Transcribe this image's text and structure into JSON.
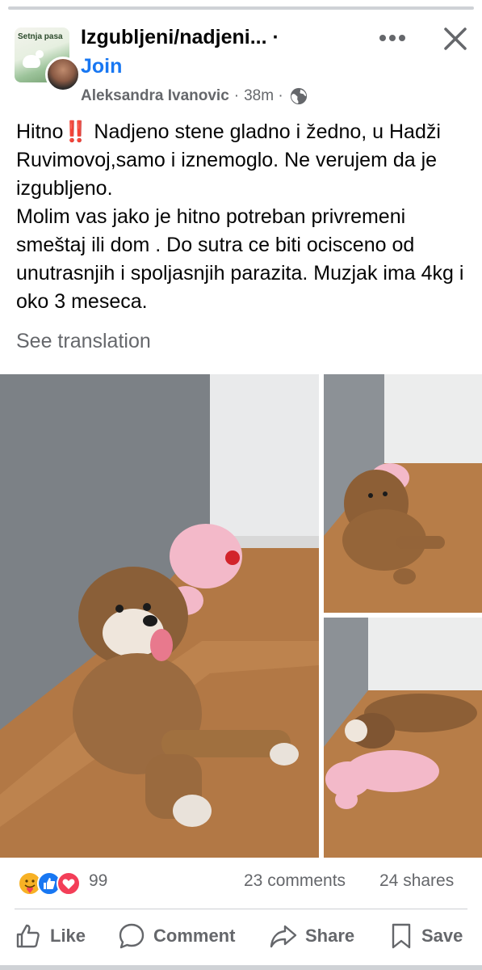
{
  "header": {
    "group_thumb_text": "Setnja pasa",
    "group_name": "Izgubljeni/nadjeni... ·",
    "join_label": "Join",
    "author": "Aleksandra Ivanovic",
    "separator": "·",
    "time": "38m ·"
  },
  "post": {
    "lines": [
      "Hitno‼️ Nadjeno stene gladno i žedno, u Hadži Ruvimovoj,samo i iznemoglo. Ne verujem da je izgubljeno.",
      "Molim vas jako je hitno potreban privremeni smeštaj ili dom . Do sutra ce biti ocisceno od unutrasnjih i spoljasnjih parazita. Muzjak ima 4kg i oko 3 meseca."
    ],
    "see_translation": "See translation"
  },
  "photos": [
    {
      "name": "puppy-photo-main",
      "subject": "puppy sitting by pink plush toy"
    },
    {
      "name": "puppy-photo-top-right",
      "subject": "puppy lying in corner"
    },
    {
      "name": "puppy-photo-bottom-right",
      "subject": "puppy sleeping next to plush toy"
    }
  ],
  "stats": {
    "reaction_count": "99",
    "comments": "23 comments",
    "shares": "24 shares",
    "reaction_icons": [
      "care-icon",
      "like-icon",
      "love-icon"
    ]
  },
  "actions": {
    "like": "Like",
    "comment": "Comment",
    "share": "Share",
    "save": "Save"
  },
  "colors": {
    "brand_blue": "#1877f2",
    "muted_text": "#65676b",
    "love_red": "#f33e58",
    "care_yellow": "#f7b125"
  }
}
